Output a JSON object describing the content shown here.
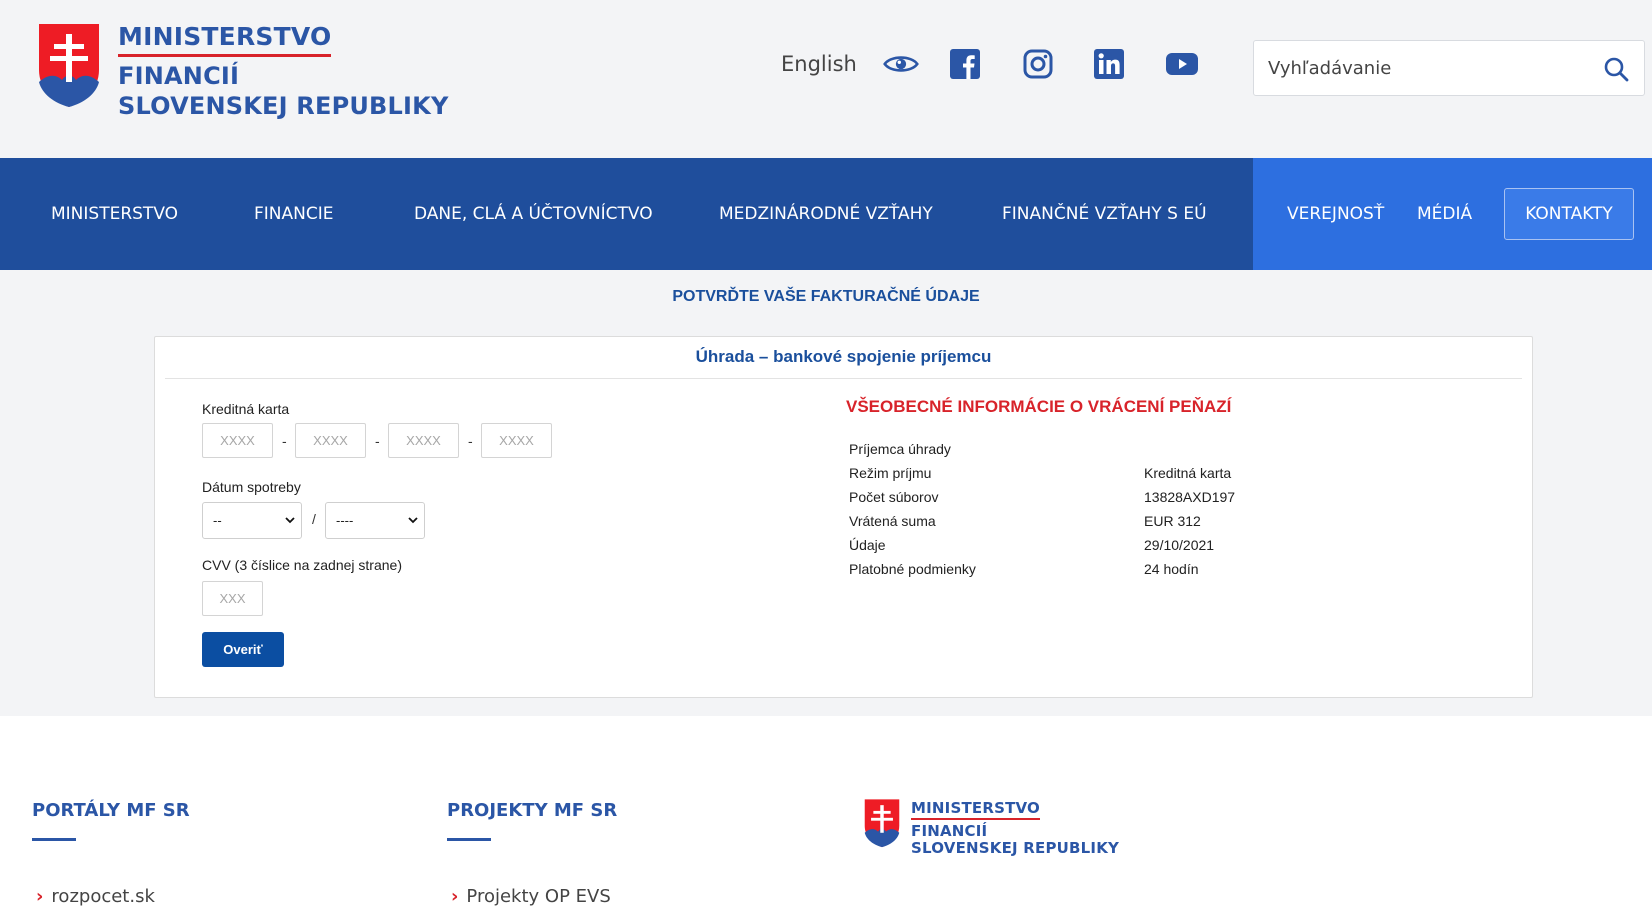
{
  "header": {
    "logo": {
      "line1": "MINISTERSTVO",
      "line2": "FINANCIÍ",
      "line3": "SLOVENSKEJ REPUBLIKY"
    },
    "language_link": "English",
    "social_icons": [
      "accessibility-eye-icon",
      "facebook-icon",
      "instagram-icon",
      "linkedin-icon",
      "youtube-icon"
    ],
    "search": {
      "placeholder": "Vyhľadávanie",
      "value": ""
    }
  },
  "nav": {
    "items": [
      "MINISTERSTVO",
      "FINANCIE",
      "DANE, CLÁ A ÚČTOVNÍCTVO",
      "MEDZINÁRODNÉ VZŤAHY",
      "FINANČNÉ VZŤAHY S EÚ",
      "VEREJNOSŤ",
      "MÉDIÁ"
    ],
    "contact_button": "KONTAKTY"
  },
  "main": {
    "page_title": "POTVRĎTE VAŠE FAKTURAČNÉ ÚDAJE",
    "card_title": "Úhrada – bankové spojenie príjemcu",
    "form": {
      "card_label": "Kreditná karta",
      "card_placeholder": "XXXX",
      "separator": "-",
      "expiry_label": "Dátum spotreby",
      "month_selected": "--",
      "year_selected": "----",
      "expiry_separator": "/",
      "cvv_label": "CVV (3 číslice na zadnej strane)",
      "cvv_placeholder": "XXX",
      "verify_button": "Overiť"
    },
    "info": {
      "title": "VŠEOBECNÉ INFORMÁCIE O VRÁCENÍ PEŇAZÍ",
      "rows": [
        {
          "key": "Príjemca úhrady",
          "value": ""
        },
        {
          "key": "Režim príjmu",
          "value": "Kreditná karta"
        },
        {
          "key": "Počet súborov",
          "value": "13828AXD197"
        },
        {
          "key": "Vrátená suma",
          "value": "EUR 312"
        },
        {
          "key": "Údaje",
          "value": "29/10/2021"
        },
        {
          "key": "Platobné podmienky",
          "value": "24 hodín"
        }
      ]
    }
  },
  "footer": {
    "portals_heading": "PORTÁLY MF SR",
    "portals_link": "rozpocet.sk",
    "projects_heading": "PROJEKTY MF SR",
    "projects_link": "Projekty OP EVS",
    "logo": {
      "line1": "MINISTERSTVO",
      "line2": "FINANCIÍ",
      "line3": "SLOVENSKEJ REPUBLIKY"
    }
  },
  "colors": {
    "nav_dark": "#1f4e9c",
    "nav_light": "#2d6fe0",
    "brand_blue": "#2b56a6",
    "accent_red": "#d8232a",
    "button_blue": "#0b4ea2"
  }
}
